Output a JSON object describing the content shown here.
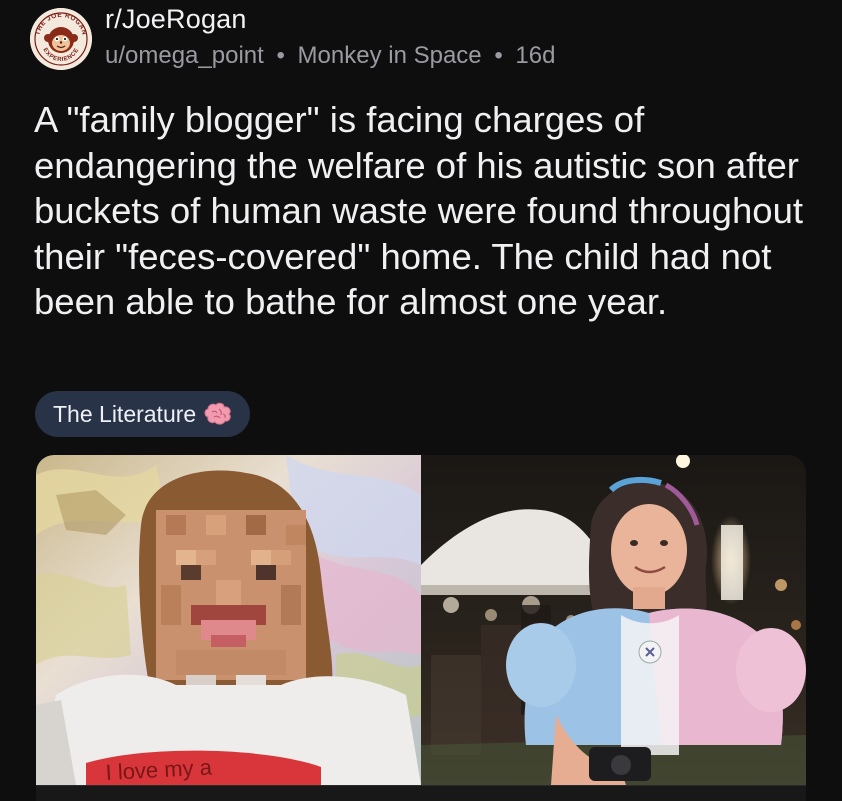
{
  "post": {
    "subreddit": "r/JoeRogan",
    "author": "u/omega_point",
    "author_flair": "Monkey in Space",
    "age": "16d",
    "separator": "•",
    "title": "A \"family blogger\" is facing charges of endangering the welfare of his autistic son after buckets of human waste were found throughout their \"feces-covered\" home. The child had not been able to bathe for almost one year.",
    "flair": "The Literature",
    "flair_icon": "brain-icon"
  },
  "avatar": {
    "logo_top": "THE JOE ROGAN",
    "logo_bottom": "EXPERIENCE"
  },
  "media": {
    "left_shirt_text": "I love my a"
  },
  "colors": {
    "background": "#0e0e0f",
    "flair_bg": "#283347",
    "meta_text": "#9a9aa2"
  }
}
